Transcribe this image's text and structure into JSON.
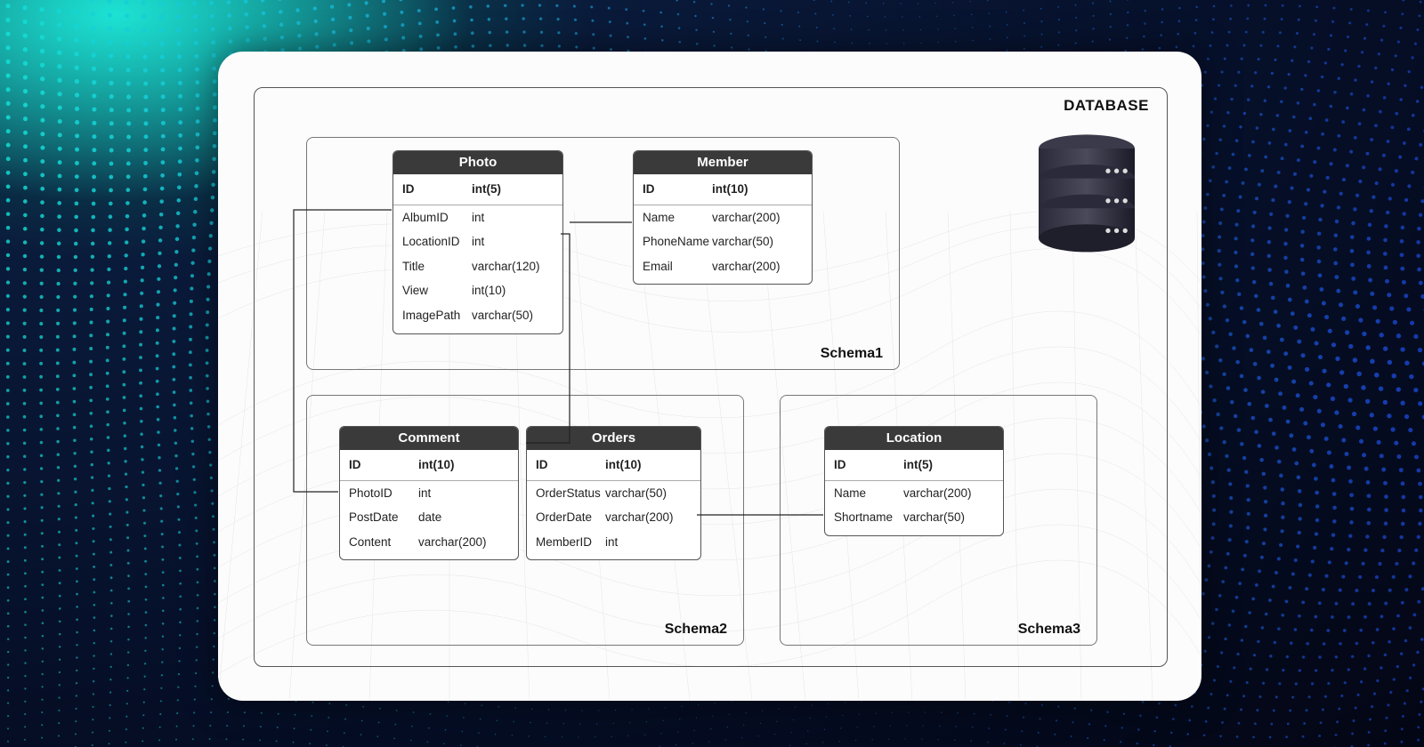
{
  "database_label": "DATABASE",
  "schemas": [
    {
      "id": "schema1",
      "label": "Schema1"
    },
    {
      "id": "schema2",
      "label": "Schema2"
    },
    {
      "id": "schema3",
      "label": "Schema3"
    }
  ],
  "tables": {
    "photo": {
      "title": "Photo",
      "pk": {
        "name": "ID",
        "type": "int(5)"
      },
      "cols": [
        {
          "name": "AlbumID",
          "type": "int"
        },
        {
          "name": "LocationID",
          "type": "int"
        },
        {
          "name": "Title",
          "type": "varchar(120)"
        },
        {
          "name": "View",
          "type": "int(10)"
        },
        {
          "name": "ImagePath",
          "type": "varchar(50)"
        }
      ]
    },
    "member": {
      "title": "Member",
      "pk": {
        "name": "ID",
        "type": "int(10)"
      },
      "cols": [
        {
          "name": "Name",
          "type": "varchar(200)"
        },
        {
          "name": "PhoneName",
          "type": "varchar(50)"
        },
        {
          "name": "Email",
          "type": "varchar(200)"
        }
      ]
    },
    "comment": {
      "title": "Comment",
      "pk": {
        "name": "ID",
        "type": "int(10)"
      },
      "cols": [
        {
          "name": "PhotoID",
          "type": "int"
        },
        {
          "name": "PostDate",
          "type": "date"
        },
        {
          "name": "Content",
          "type": "varchar(200)"
        }
      ]
    },
    "orders": {
      "title": "Orders",
      "pk": {
        "name": "ID",
        "type": "int(10)"
      },
      "cols": [
        {
          "name": "OrderStatus",
          "type": "varchar(50)"
        },
        {
          "name": "OrderDate",
          "type": "varchar(200)"
        },
        {
          "name": "MemberID",
          "type": "int"
        }
      ]
    },
    "location": {
      "title": "Location",
      "pk": {
        "name": "ID",
        "type": "int(5)"
      },
      "cols": [
        {
          "name": "Name",
          "type": "varchar(200)"
        },
        {
          "name": "Shortname",
          "type": "varchar(50)"
        }
      ]
    }
  }
}
